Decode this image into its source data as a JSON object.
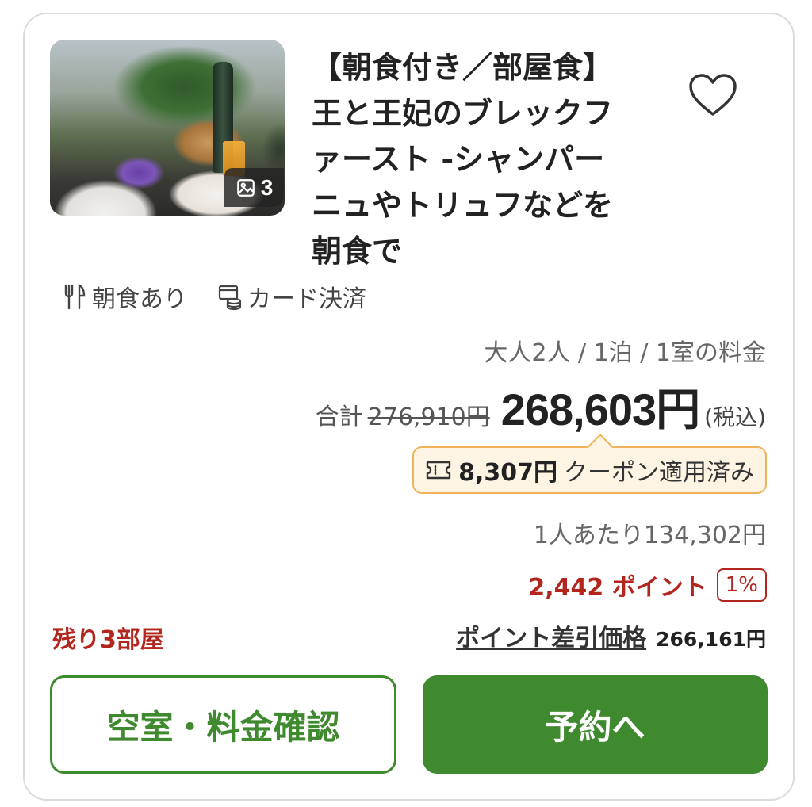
{
  "plan": {
    "title_lines": [
      "【朝食付き／部屋食】",
      "王と王妃のブレックフ",
      "ァースト -シャンパー",
      "ニュやトリュフなどを",
      "朝食で"
    ],
    "photo_count": "3",
    "icons": {
      "photo": "image-icon",
      "favorite": "heart-outline-icon"
    }
  },
  "features": [
    {
      "label": "朝食あり",
      "icon": "cutlery-icon"
    },
    {
      "label": "カード決済",
      "icon": "card-coins-icon"
    }
  ],
  "price": {
    "conditions": "大人2人 / 1泊 / 1室の料金",
    "total_label": "合計",
    "original": "276,910円",
    "current": "268,603円",
    "tax_note": "(税込)",
    "coupon_amount": "8,307円",
    "coupon_text": "クーポン適用済み",
    "per_person": "1人あたり134,302円",
    "points": "2,442 ポイント",
    "point_rate": "1%",
    "point_price_label": "ポイント差引価格",
    "point_price": "266,161円"
  },
  "availability": {
    "remaining": "残り3部屋"
  },
  "actions": {
    "check_label": "空室・料金確認",
    "book_label": "予約へ"
  },
  "colors": {
    "accent_green": "#3f8a2e",
    "accent_red": "#b3261e",
    "coupon_bg": "#fdf4e4",
    "coupon_border": "#f0b35a"
  }
}
